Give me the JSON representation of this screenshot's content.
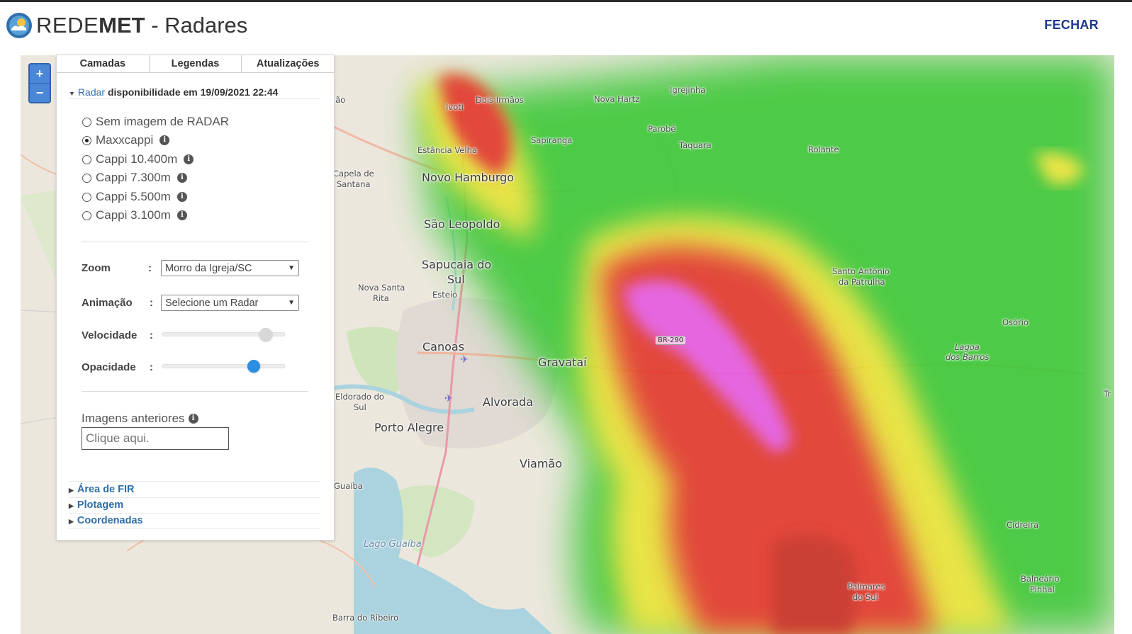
{
  "header": {
    "brand_rede": "REDE",
    "brand_met": "MET",
    "brand_rest": " - Radares",
    "close_label": "FECHAR"
  },
  "zoom_controls": {
    "zoom_in": "+",
    "zoom_out": "−"
  },
  "panel": {
    "tabs": [
      {
        "label": "Camadas"
      },
      {
        "label": "Legendas"
      },
      {
        "label": "Atualizações"
      }
    ],
    "radar_section": {
      "link": "Radar",
      "availability": "disponibilidade em 19/09/2021 22:44"
    },
    "radar_options": [
      {
        "label": "Sem imagem de RADAR",
        "selected": false,
        "info": false
      },
      {
        "label": "Maxxcappi",
        "selected": true,
        "info": true
      },
      {
        "label": "Cappi 10.400m",
        "selected": false,
        "info": true
      },
      {
        "label": "Cappi 7.300m",
        "selected": false,
        "info": true
      },
      {
        "label": "Cappi 5.500m",
        "selected": false,
        "info": true
      },
      {
        "label": "Cappi 3.100m",
        "selected": false,
        "info": true
      }
    ],
    "zoom": {
      "label": "Zoom",
      "colon": ":",
      "value": "Morro da Igreja/SC"
    },
    "animation": {
      "label": "Animação",
      "colon": ":",
      "value": "Selecione um Radar"
    },
    "speed": {
      "label": "Velocidade",
      "colon": ":",
      "level": 0.89
    },
    "opacity": {
      "label": "Opacidade",
      "colon": ":",
      "level": 0.78
    },
    "previous_images": {
      "label": "Imagens anteriores",
      "placeholder": "Clique aqui."
    },
    "collapsibles": [
      {
        "label": "Área de FIR"
      },
      {
        "label": "Plotagem"
      },
      {
        "label": "Coordenadas"
      }
    ]
  },
  "map": {
    "labels": {
      "dois_irmaos": "Dois Irmãos",
      "ivoti": "Ivoti",
      "nova_hartz": "Nova Hartz",
      "igrejinha": "Igrejinha",
      "parobe": "Parobé",
      "taquara": "Taquara",
      "sapiranga": "Sapiranga",
      "rolante": "Rolante",
      "estancia_velha": "Estância Velha",
      "capela_1": "Capela de",
      "capela_2": "Santana",
      "novo_hamburgo": "Novo Hamburgo",
      "sao_leopoldo": "São Leopoldo",
      "sapucaia_1": "Sapucaia do",
      "sapucaia_2": "Sul",
      "esteio": "Esteio",
      "nova_santa_1": "Nova Santa",
      "nova_santa_2": "Rita",
      "santo_antonio_1": "Santo Antônio",
      "santo_antonio_2": "da Patrulha",
      "osorio": "Osório",
      "lagoa_1": "Lagoa",
      "lagoa_2": "dos Barros",
      "canoas": "Canoas",
      "gravatai": "Gravataí",
      "br290": "BR-290",
      "eldorado_1": "Eldorado do",
      "eldorado_2": "Sul",
      "alvorada": "Alvorada",
      "porto_alegre": "Porto Alegre",
      "viamao": "Viamão",
      "guaiba": "Guaíba",
      "lago_guaiba": "Lago Guaíba",
      "cidreira": "Cidreira",
      "palmares_1": "Palmares",
      "palmares_2": "do Sul",
      "balneario_1": "Balneário",
      "balneario_2": "Pinhal",
      "barra_ribeiro": "Barra do Ribeiro",
      "iao": "ião",
      "tr": "Tr"
    },
    "colors": {
      "base": "#ece7dd",
      "water": "#aad3df",
      "radar_green": "#3fc83a",
      "radar_yellow": "#e8e43a",
      "radar_red": "#e23a2f",
      "radar_magenta": "#e55be0"
    }
  }
}
